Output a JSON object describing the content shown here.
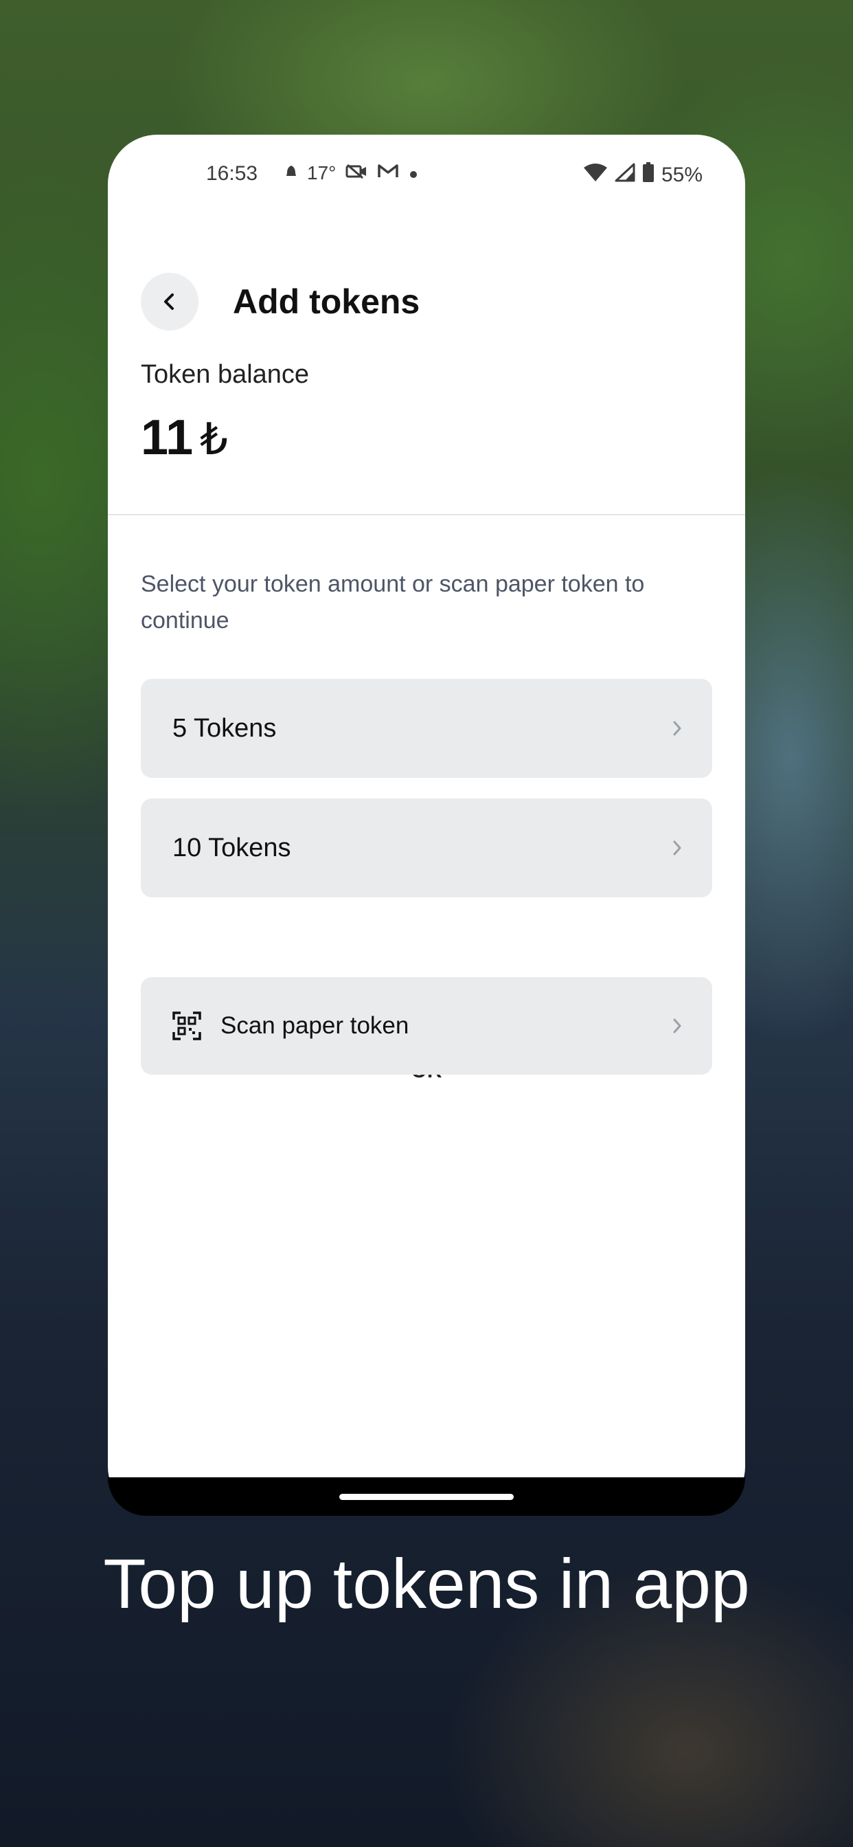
{
  "status_bar": {
    "time": "16:53",
    "temperature": "17°",
    "battery": "55%",
    "icons": [
      "notification-icon",
      "camera-off-icon",
      "gmail-icon",
      "dot-icon",
      "wifi-icon",
      "cell-signal-icon",
      "battery-icon"
    ]
  },
  "header": {
    "title": "Add tokens",
    "back_icon": "chevron-left-icon"
  },
  "balance": {
    "label": "Token balance",
    "value": "11",
    "unit": "₺"
  },
  "instruction": "Select your token amount or scan paper token to continue",
  "options": [
    {
      "label": "5 Tokens"
    },
    {
      "label": "10 Tokens"
    }
  ],
  "or_label": "OR",
  "scan": {
    "label": "Scan paper token",
    "icon": "qr-code-icon"
  },
  "caption": "Top up tokens in app",
  "colors": {
    "card_bg": "#ffffff",
    "option_bg": "#e9ebed",
    "instruction_text": "#4d5566",
    "caption_text": "#ffffff"
  }
}
